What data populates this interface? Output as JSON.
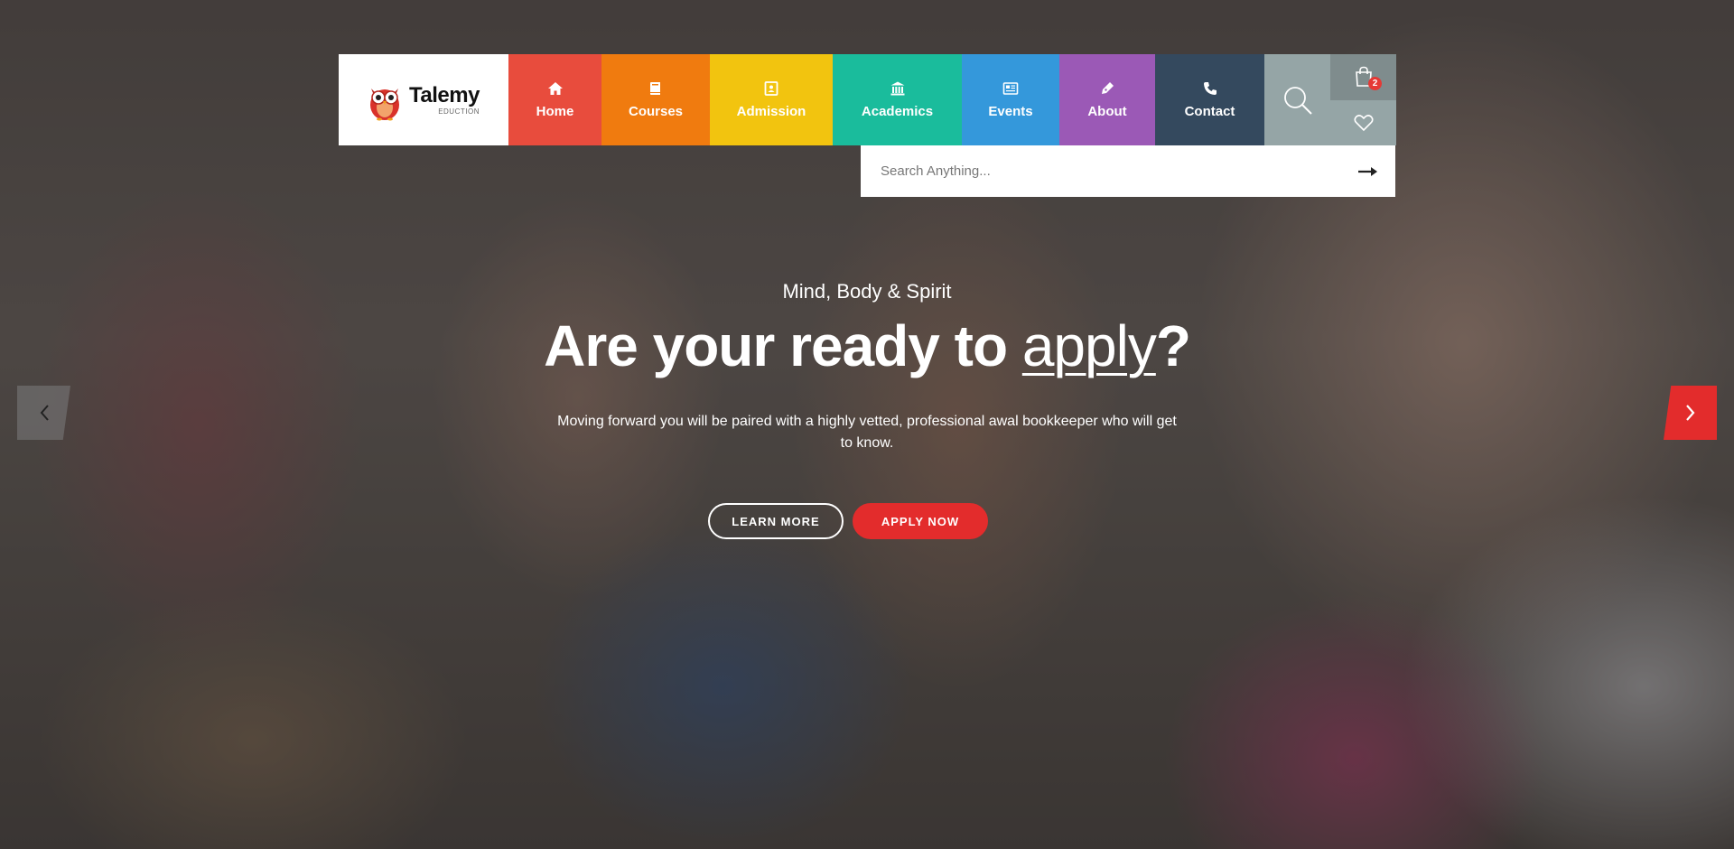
{
  "brand": {
    "name": "Talemy",
    "tagline": "EDUCTION",
    "logo_icon": "owl-icon"
  },
  "nav": {
    "items": [
      {
        "label": "Home",
        "icon": "home-icon",
        "color": "#e84c3d"
      },
      {
        "label": "Courses",
        "icon": "book-icon",
        "color": "#f07b0f"
      },
      {
        "label": "Admission",
        "icon": "id-card-icon",
        "color": "#f2c40f"
      },
      {
        "label": "Academics",
        "icon": "bank-icon",
        "color": "#1abc9c"
      },
      {
        "label": "Events",
        "icon": "newspaper-icon",
        "color": "#3498db"
      },
      {
        "label": "About",
        "icon": "pen-icon",
        "color": "#9b59b6"
      },
      {
        "label": "Contact",
        "icon": "phone-icon",
        "color": "#34495e"
      }
    ],
    "search_tile_color": "#95a5a6",
    "side_tile_color": "#7f8c8d",
    "cart_count": "2"
  },
  "search": {
    "placeholder": "Search Anything..."
  },
  "hero": {
    "tagline": "Mind, Body & Spirit",
    "headline_prefix": "Are your ready to ",
    "headline_highlight": "apply",
    "headline_suffix": "?",
    "description": "Moving forward you will be paired with a highly vetted, professional awal bookkeeper who will get to know.",
    "buttons": {
      "learn_more": "LEARN MORE",
      "apply_now": "APPLY NOW"
    },
    "accent_color": "#e32c2c"
  }
}
